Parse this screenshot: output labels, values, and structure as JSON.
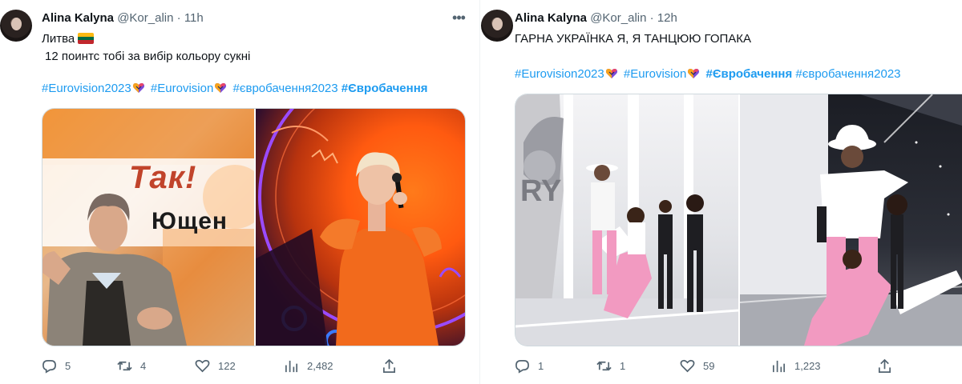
{
  "tweets": [
    {
      "author": "Alina Kalyna",
      "handle": "@Kor_alin",
      "separator": "·",
      "time": "11h",
      "lines": [
        "Литва",
        "12 поинтс тобі за вибір кольору сукні"
      ],
      "hashtags": [
        "#Eurovision2023",
        "#Eurovision",
        "#євробачення2023",
        "#Євробачення"
      ],
      "media_texts": [
        "Так!",
        "Ющен"
      ],
      "stats": {
        "replies": "5",
        "retweets": "4",
        "likes": "122",
        "views": "2,482"
      }
    },
    {
      "author": "Alina Kalyna",
      "handle": "@Kor_alin",
      "separator": "·",
      "time": "12h",
      "lines": [
        "ГАРНА УКРАЇНКА Я, Я ТАНЦЮЮ ГОПАКА"
      ],
      "hashtags": [
        "#Eurovision2023",
        "#Eurovision",
        "#Євробачення",
        "#євробачення2023"
      ],
      "media_texts": [
        "RY"
      ],
      "stats": {
        "replies": "1",
        "retweets": "1",
        "likes": "59",
        "views": "1,223"
      }
    }
  ],
  "icons": [
    "avatar",
    "more-icon",
    "lithuania-flag-icon",
    "eurovision-heart-icon",
    "reply-icon",
    "retweet-icon",
    "like-icon",
    "views-icon",
    "share-icon"
  ],
  "colors": {
    "link": "#1d9bf0",
    "text": "#0f1419",
    "muted": "#536471",
    "border": "#cfd9de"
  }
}
